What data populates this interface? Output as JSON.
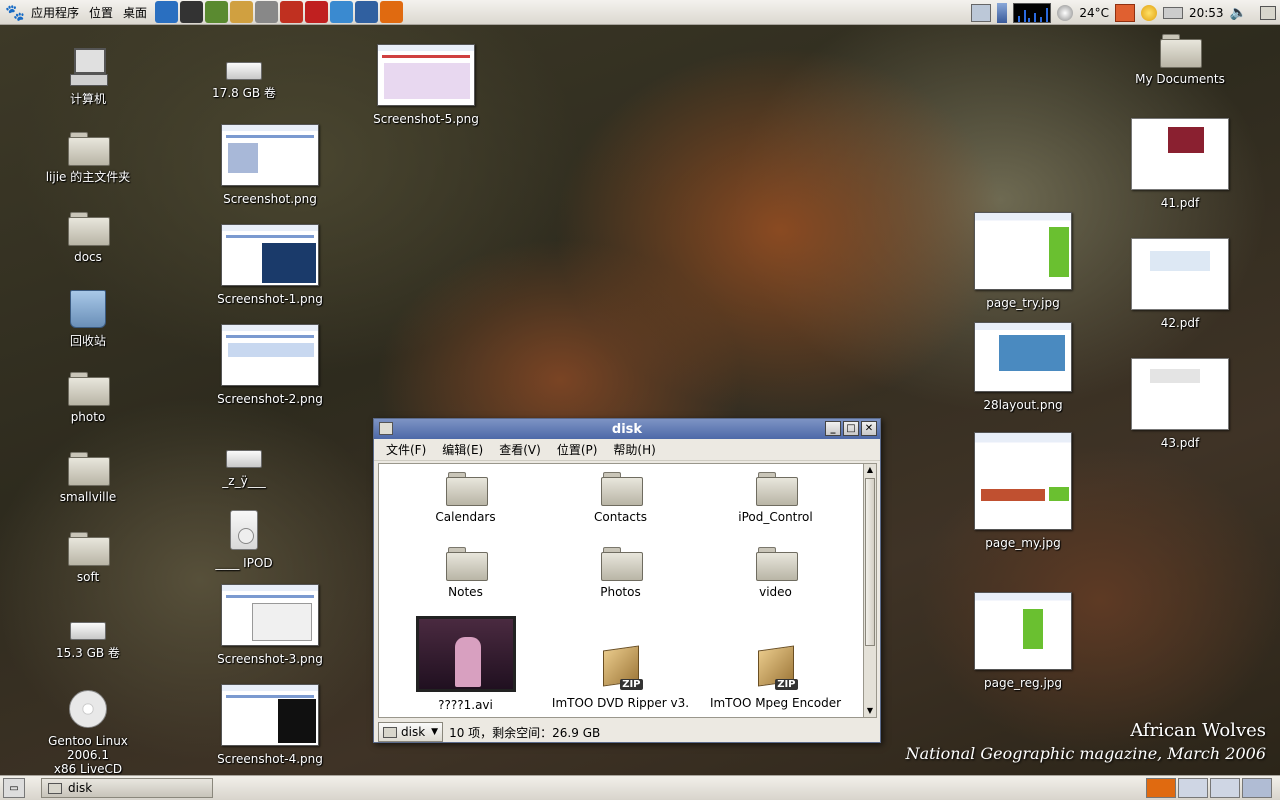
{
  "top_panel": {
    "menus": [
      "应用程序",
      "位置",
      "桌面"
    ],
    "launchers": [
      {
        "icon": "world-globe-icon",
        "color": "#2a6fc0"
      },
      {
        "icon": "terminal-icon",
        "color": "#333333"
      },
      {
        "icon": "books-icon",
        "color": "#5a8a30"
      },
      {
        "icon": "person-icon",
        "color": "#d0a040"
      },
      {
        "icon": "text-editor-icon",
        "color": "#888888"
      },
      {
        "icon": "penguin-qq-icon",
        "color": "#c03020"
      },
      {
        "icon": "red-app-icon",
        "color": "#c02020"
      },
      {
        "icon": "blue-puzzle-icon",
        "color": "#3a8ad0"
      },
      {
        "icon": "network-tool-icon",
        "color": "#3060a0"
      },
      {
        "icon": "firefox-icon",
        "color": "#e06a10"
      }
    ],
    "temperature": "24°C",
    "clock": "20:53"
  },
  "desktop_left": [
    {
      "label": "计算机",
      "icon": "computer-icon"
    },
    {
      "label": "lijie 的主文件夹",
      "icon": "home-folder-icon"
    },
    {
      "label": "docs",
      "icon": "folder-icon"
    },
    {
      "label": "回收站",
      "icon": "trash-icon"
    },
    {
      "label": "photo",
      "icon": "folder-icon"
    },
    {
      "label": "smallville",
      "icon": "folder-icon"
    },
    {
      "label": "soft",
      "icon": "folder-icon"
    },
    {
      "label": "15.3 GB 卷",
      "icon": "drive-icon"
    },
    {
      "label": "Gentoo Linux 2006.1\nx86 LiveCD",
      "icon": "cdrom-icon"
    }
  ],
  "desktop_col2": [
    {
      "label": "17.8 GB 卷",
      "icon": "usb-drive-icon"
    },
    {
      "label": "Screenshot.png",
      "icon": "image-thumbnail"
    },
    {
      "label": "Screenshot-1.png",
      "icon": "image-thumbnail"
    },
    {
      "label": "Screenshot-2.png",
      "icon": "image-thumbnail"
    },
    {
      "label": "_z_ÿ___",
      "icon": "usb-drive-icon"
    },
    {
      "label": "____ IPOD",
      "icon": "ipod-icon"
    },
    {
      "label": "Screenshot-3.png",
      "icon": "image-thumbnail"
    },
    {
      "label": "Screenshot-4.png",
      "icon": "image-thumbnail"
    }
  ],
  "desktop_col3": [
    {
      "label": "Screenshot-5.png",
      "icon": "image-thumbnail"
    }
  ],
  "desktop_right": [
    {
      "label": "My Documents",
      "icon": "folder-icon"
    },
    {
      "label": "41.pdf",
      "icon": "pdf-thumbnail"
    },
    {
      "label": "42.pdf",
      "icon": "pdf-thumbnail"
    },
    {
      "label": "43.pdf",
      "icon": "pdf-thumbnail"
    }
  ],
  "desktop_right2": [
    {
      "label": "page_try.jpg",
      "icon": "image-thumbnail"
    },
    {
      "label": "28layout.png",
      "icon": "image-thumbnail"
    },
    {
      "label": "page_my.jpg",
      "icon": "image-thumbnail"
    },
    {
      "label": "page_reg.jpg",
      "icon": "image-thumbnail"
    }
  ],
  "window": {
    "title": "disk",
    "menu": [
      "文件(F)",
      "编辑(E)",
      "查看(V)",
      "位置(P)",
      "帮助(H)"
    ],
    "items": [
      {
        "label": "Calendars",
        "type": "folder"
      },
      {
        "label": "Contacts",
        "type": "folder"
      },
      {
        "label": "iPod_Control",
        "type": "folder"
      },
      {
        "label": "Notes",
        "type": "folder"
      },
      {
        "label": "Photos",
        "type": "folder"
      },
      {
        "label": "video",
        "type": "folder"
      },
      {
        "label": "????1.avi",
        "type": "video"
      },
      {
        "label": "ImTOO DVD Ripper v3.",
        "type": "zip"
      },
      {
        "label": "ImTOO Mpeg Encoder",
        "type": "zip"
      }
    ],
    "location": "disk",
    "status": "10 项，剩余空间：26.9 GB",
    "zip_badge": "ZIP"
  },
  "wallpaper_caption": {
    "line1": "African Wolves",
    "line2": "National Geographic magazine, March 2006"
  },
  "bottom_panel": {
    "task": "disk"
  }
}
